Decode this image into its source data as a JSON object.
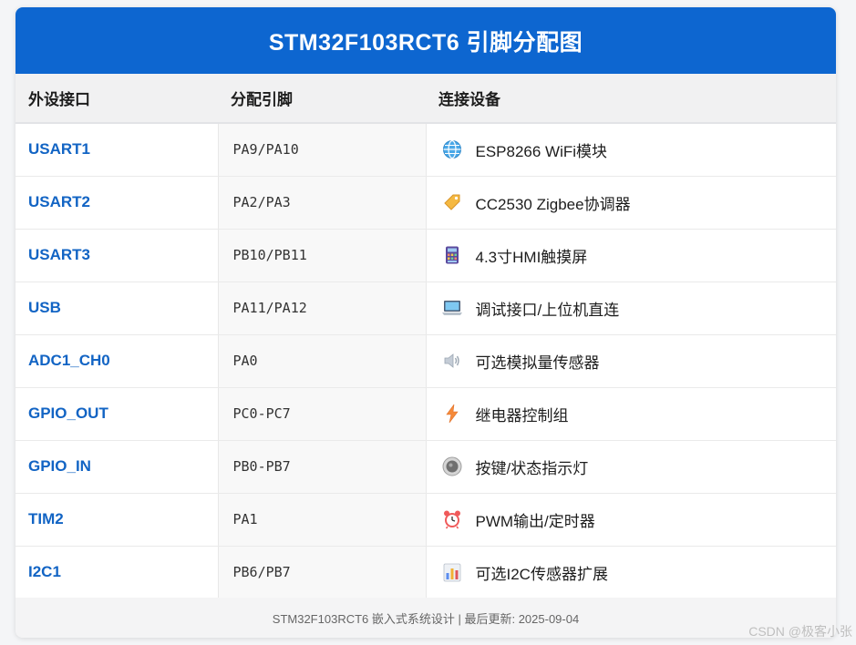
{
  "page": {
    "title": "STM32F103RCT6 引脚分配图",
    "footer": "STM32F103RCT6 嵌入式系统设计 | 最后更新: 2025-09-04",
    "watermark": "CSDN @极客小张"
  },
  "table": {
    "headers": [
      "外设接口",
      "分配引脚",
      "连接设备"
    ],
    "rows": [
      {
        "interface": "USART1",
        "pins": "PA9/PA10",
        "device": "ESP8266 WiFi模块",
        "icon": "globe-icon"
      },
      {
        "interface": "USART2",
        "pins": "PA2/PA3",
        "device": "CC2530 Zigbee协调器",
        "icon": "tag-icon"
      },
      {
        "interface": "USART3",
        "pins": "PB10/PB11",
        "device": "4.3寸HMI触摸屏",
        "icon": "calculator-icon"
      },
      {
        "interface": "USB",
        "pins": "PA11/PA12",
        "device": "调试接口/上位机直连",
        "icon": "laptop-icon"
      },
      {
        "interface": "ADC1_CH0",
        "pins": "PA0",
        "device": "可选模拟量传感器",
        "icon": "speaker-icon"
      },
      {
        "interface": "GPIO_OUT",
        "pins": "PC0-PC7",
        "device": "继电器控制组",
        "icon": "lightning-icon"
      },
      {
        "interface": "GPIO_IN",
        "pins": "PB0-PB7",
        "device": "按键/状态指示灯",
        "icon": "radio-button-icon"
      },
      {
        "interface": "TIM2",
        "pins": "PA1",
        "device": "PWM输出/定时器",
        "icon": "alarm-clock-icon"
      },
      {
        "interface": "I2C1",
        "pins": "PB6/PB7",
        "device": "可选I2C传感器扩展",
        "icon": "bar-chart-icon"
      }
    ]
  },
  "colors": {
    "title_bar": "#0d66d0",
    "interface_text": "#1264c4"
  }
}
